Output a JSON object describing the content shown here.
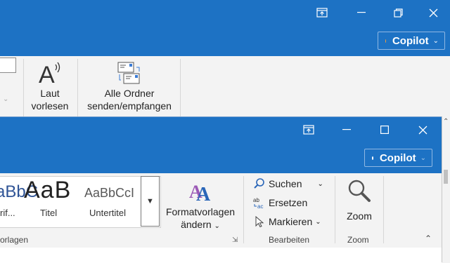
{
  "colors": {
    "titlebar": "#1d72c4",
    "copilot_dot_back": "#f29b3a",
    "copilot_dot_front": "#ffffff"
  },
  "back_window": {
    "title_buttons": [
      "restore-window-icon",
      "minimize-icon",
      "maximize-icon",
      "close-icon"
    ],
    "copilot_label": "Copilot",
    "ribbon": {
      "read_aloud": {
        "line1": "Laut",
        "line2": "vorlesen"
      },
      "send_receive": {
        "line1": "Alle Ordner",
        "line2": "senden/empfangen"
      }
    }
  },
  "front_window": {
    "copilot_label": "Copilot",
    "styles": [
      {
        "sample": "aBbC",
        "name": "rif..."
      },
      {
        "sample": "AaB",
        "name": "Titel"
      },
      {
        "sample": "AaBbCcI",
        "name": "Untertitel"
      }
    ],
    "styles_group_label": "orlagen",
    "format_templates": {
      "line1": "Formatvorlagen",
      "line2": "ändern"
    },
    "editing": {
      "search": "Suchen",
      "replace": "Ersetzen",
      "select": "Markieren",
      "group_label": "Bearbeiten"
    },
    "zoom": {
      "label": "Zoom",
      "group_label": "Zoom"
    }
  }
}
